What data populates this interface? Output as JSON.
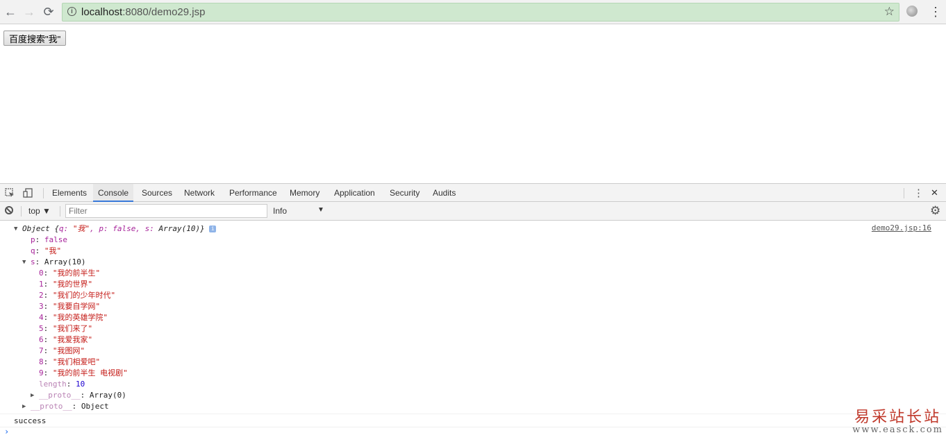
{
  "browser": {
    "url_host": "localhost",
    "url_rest": ":8080/demo29.jsp",
    "back_glyph": "←",
    "forward_glyph": "→",
    "reload_glyph": "⟳",
    "star_glyph": "☆",
    "menu_glyph": "⋮"
  },
  "page": {
    "button_label": "百度搜索\"我\""
  },
  "devtools": {
    "tabs": [
      {
        "label": "Elements"
      },
      {
        "label": "Console"
      },
      {
        "label": "Sources"
      },
      {
        "label": "Network"
      },
      {
        "label": "Performance"
      },
      {
        "label": "Memory"
      },
      {
        "label": "Application"
      },
      {
        "label": "Security"
      },
      {
        "label": "Audits"
      }
    ],
    "active_tab": "Console",
    "menu_glyph": "⋮",
    "close_glyph": "✕",
    "toolbar": {
      "context": "top ▼",
      "filter_placeholder": "Filter",
      "level": "Info",
      "level_arrow": "▼"
    }
  },
  "console": {
    "source": "demo29.jsp:16",
    "object_summary_prefix": "Object {",
    "object_summary_q": "q: ",
    "object_summary_q_val": "\"我\"",
    "object_summary_p": ", p: ",
    "object_summary_p_val": "false",
    "object_summary_s": ", s: ",
    "object_summary_s_val": "Array(10)}",
    "info_badge": "i",
    "p_key": "p",
    "p_val": "false",
    "q_key": "q",
    "q_val": "\"我\"",
    "s_key": "s",
    "s_val": "Array(10)",
    "array_items": [
      {
        "index": "0",
        "value": "\"我的前半生\""
      },
      {
        "index": "1",
        "value": "\"我的世界\""
      },
      {
        "index": "2",
        "value": "\"我们的少年时代\""
      },
      {
        "index": "3",
        "value": "\"我要自学网\""
      },
      {
        "index": "4",
        "value": "\"我的英雄学院\""
      },
      {
        "index": "5",
        "value": "\"我们来了\""
      },
      {
        "index": "6",
        "value": "\"我爱我家\""
      },
      {
        "index": "7",
        "value": "\"我图网\""
      },
      {
        "index": "8",
        "value": "\"我们相爱吧\""
      },
      {
        "index": "9",
        "value": "\"我的前半生 电视剧\""
      }
    ],
    "length_key": "length",
    "length_val": "10",
    "proto_key": "__proto__",
    "proto_array_val": "Array(0)",
    "proto_object_val": "Object",
    "success": "success",
    "prompt": "›"
  },
  "watermark": {
    "chinese": "易采站长站",
    "english": "www.easck.com"
  },
  "colors": {
    "omnibox_bg": "#cfe8cf",
    "active_tab_underline": "#3879d9",
    "string_color": "#c41a16",
    "key_color": "#a7249a",
    "number_color": "#1c00cf"
  }
}
